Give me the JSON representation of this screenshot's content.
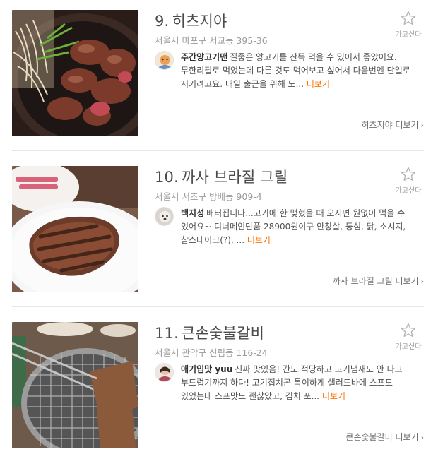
{
  "restaurants": [
    {
      "rank": "9.",
      "name": "히츠지야",
      "address": "서울시 마포구 서교동 395-36",
      "wish_label": "가고싶다",
      "review": {
        "user": "주간양고기맨",
        "text": "질좋은 양고기를 잔뜩 먹을 수 있어서 좋았어요. 무한리필로 먹었는데 다른 것도 먹어보고 싶어서 다음번엔 단일로 시키려고요. 내일 출근을 위해 노...",
        "more": "더보기"
      },
      "detail_link": "히츠지야 더보기"
    },
    {
      "rank": "10.",
      "name": "까사 브라질 그릴",
      "address": "서울시 서초구 방배동 909-4",
      "wish_label": "가고싶다",
      "review": {
        "user": "백지성",
        "text": "배터집니다...고기에 한 맺혔을 때 오시면 원없이 먹을 수 있어요~ 디너메인단품 28900원이구 안창살, 등심, 닭, 소시지, 참스테이크(?), ...",
        "more": "더보기"
      },
      "detail_link": "까사 브라질 그릴 더보기"
    },
    {
      "rank": "11.",
      "name": "큰손숯불갈비",
      "address": "서울시 관악구 신림동 116-24",
      "wish_label": "가고싶다",
      "review": {
        "user": "애기입맛 yuu",
        "text": "진짜 맛있음! 간도 적당하고 고기냄새도 안 나고 부드럽기까지 하다! 고기집치곤 특이하게 샐러드바에 스프도 있었는데 스프맛도 괜찮았고, 김치 포...",
        "more": "더보기"
      },
      "detail_link": "큰손숯불갈비 더보기"
    }
  ],
  "icons": {
    "wish": "star-outline-icon",
    "chevron": "chevron-right-icon"
  },
  "colors": {
    "more_link": "#ff7100",
    "divider": "#e6e6e6",
    "muted_text": "#9b9b9b"
  }
}
